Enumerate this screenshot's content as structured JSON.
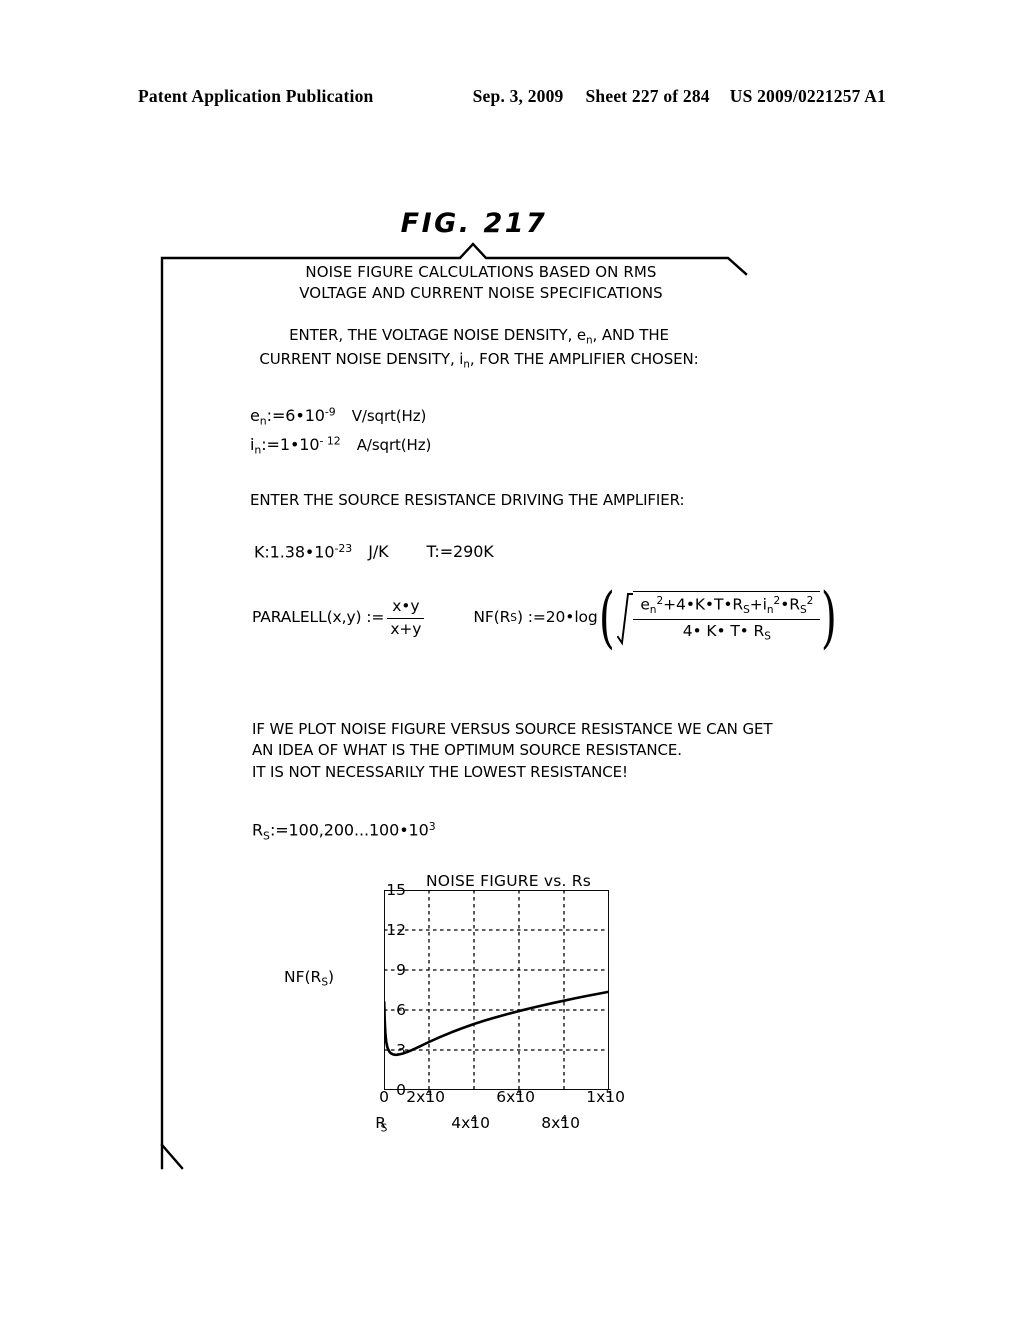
{
  "header": {
    "publication": "Patent Application Publication",
    "date": "Sep. 3, 2009",
    "sheet": "Sheet 227 of 284",
    "number": "US 2009/0221257 A1"
  },
  "figure": {
    "label": "FIG. 217"
  },
  "worksheet": {
    "title_line1": "NOISE FIGURE CALCULATIONS BASED ON RMS",
    "title_line2": "VOLTAGE AND CURRENT NOISE SPECIFICATIONS",
    "intro_line1_a": "ENTER, THE VOLTAGE NOISE DENSITY, e",
    "intro_line1_sub": "n",
    "intro_line1_b": ", AND THE",
    "intro_line2_a": "CURRENT NOISE DENSITY, i",
    "intro_line2_sub": "n",
    "intro_line2_b": ", FOR THE AMPLIFIER CHOSEN:",
    "def_en_var": "e",
    "def_en_sub": "n",
    "def_en_body": ":=6",
    "def_en_dot": "•",
    "def_en_base": "10",
    "def_en_exp": "-9",
    "def_en_unit": "V/sqrt(Hz)",
    "def_in_var": "i",
    "def_in_sub": "n",
    "def_in_body": ":=1",
    "def_in_dot": "•",
    "def_in_base": "10",
    "def_in_exp": "- 12",
    "def_in_unit": "A/sqrt(Hz)",
    "enter_resistance": "ENTER THE SOURCE RESISTANCE DRIVING THE AMPLIFIER:",
    "const_k": "K:1.38",
    "const_k_dot": "•",
    "const_k_base": "10",
    "const_k_exp": "-23",
    "const_k_unit": "J/K",
    "const_t": "T:=290K",
    "paralell_name": "PARALELL(x,y) :=",
    "paralell_num": "x•y",
    "paralell_den": "x+y",
    "nf_lhs_a": "NF(R",
    "nf_lhs_sub": "S",
    "nf_lhs_b": ") :=20",
    "nf_lhs_dot": "•",
    "nf_lhs_log": "log",
    "nf_num": {
      "e": "e",
      "e_sub": "n",
      "e_sup": "2",
      "mid": "+4•K•T•R",
      "rs_sub1": "S",
      "plus_i": "+i",
      "i_sub": "n",
      "i_sup": "2",
      "dot_r": "•R",
      "rs_sub2": "S",
      "rs_sup2": "2"
    },
    "nf_den": {
      "text": "4• K• T• R",
      "sub": "S"
    },
    "para_line1": "IF WE PLOT NOISE FIGURE VERSUS SOURCE RESISTANCE WE CAN GET",
    "para_line2": "AN IDEA OF WHAT IS THE OPTIMUM SOURCE RESISTANCE.",
    "para_line3": "IT IS NOT NECESSARILY THE LOWEST RESISTANCE!",
    "range_var": "R",
    "range_sub": "S",
    "range_body": ":=100,200...100",
    "range_dot": "•",
    "range_base": "10",
    "range_exp": "3"
  },
  "chart_data": {
    "type": "line",
    "title": "NOISE FIGURE vs. Rs",
    "ylabel": "NF(R",
    "ylabel_sub": "S",
    "ylabel_close": ")",
    "xlabel_var": "R",
    "xlabel_sub": "S",
    "xlim": [
      0,
      100000
    ],
    "ylim": [
      0,
      15
    ],
    "yticks": [
      0,
      3,
      6,
      9,
      12,
      15
    ],
    "ytick_labels": [
      "0",
      "3",
      "6",
      "9",
      "12",
      "15"
    ],
    "xticks": [
      0,
      20000,
      40000,
      60000,
      80000,
      100000
    ],
    "xtick_labels_top": [
      {
        "value": 0,
        "mantissa": "0",
        "base": "",
        "exp": ""
      },
      {
        "value": 20000,
        "mantissa": "2x10",
        "base": "",
        "exp": "4"
      },
      {
        "value": 60000,
        "mantissa": "6x10",
        "base": "",
        "exp": "4"
      },
      {
        "value": 100000,
        "mantissa": "1x10",
        "base": "",
        "exp": "5"
      }
    ],
    "xtick_labels_bottom": [
      {
        "value": 40000,
        "mantissa": "4x10",
        "exp": "4"
      },
      {
        "value": 80000,
        "mantissa": "8x10",
        "exp": "4"
      }
    ],
    "grid": true,
    "grid_style": "dashed",
    "series": [
      {
        "name": "NF(Rs)",
        "x": [
          100,
          300,
          600,
          1000,
          1500,
          2000,
          2500,
          3000,
          4000,
          5000,
          6000,
          7000,
          8000,
          9000,
          10000,
          12000,
          14000,
          16000,
          18000,
          20000,
          25000,
          30000,
          35000,
          40000,
          45000,
          50000,
          55000,
          60000,
          65000,
          70000,
          75000,
          80000,
          85000,
          90000,
          95000,
          100000
        ],
        "y": [
          6.6,
          5.3,
          4.3,
          3.6,
          3.2,
          3.0,
          2.85,
          2.76,
          2.67,
          2.64,
          2.65,
          2.68,
          2.72,
          2.77,
          2.83,
          2.97,
          3.12,
          3.28,
          3.44,
          3.6,
          3.98,
          4.33,
          4.65,
          4.95,
          5.22,
          5.47,
          5.7,
          5.92,
          6.13,
          6.33,
          6.52,
          6.7,
          6.88,
          7.05,
          7.21,
          7.37
        ]
      }
    ]
  }
}
